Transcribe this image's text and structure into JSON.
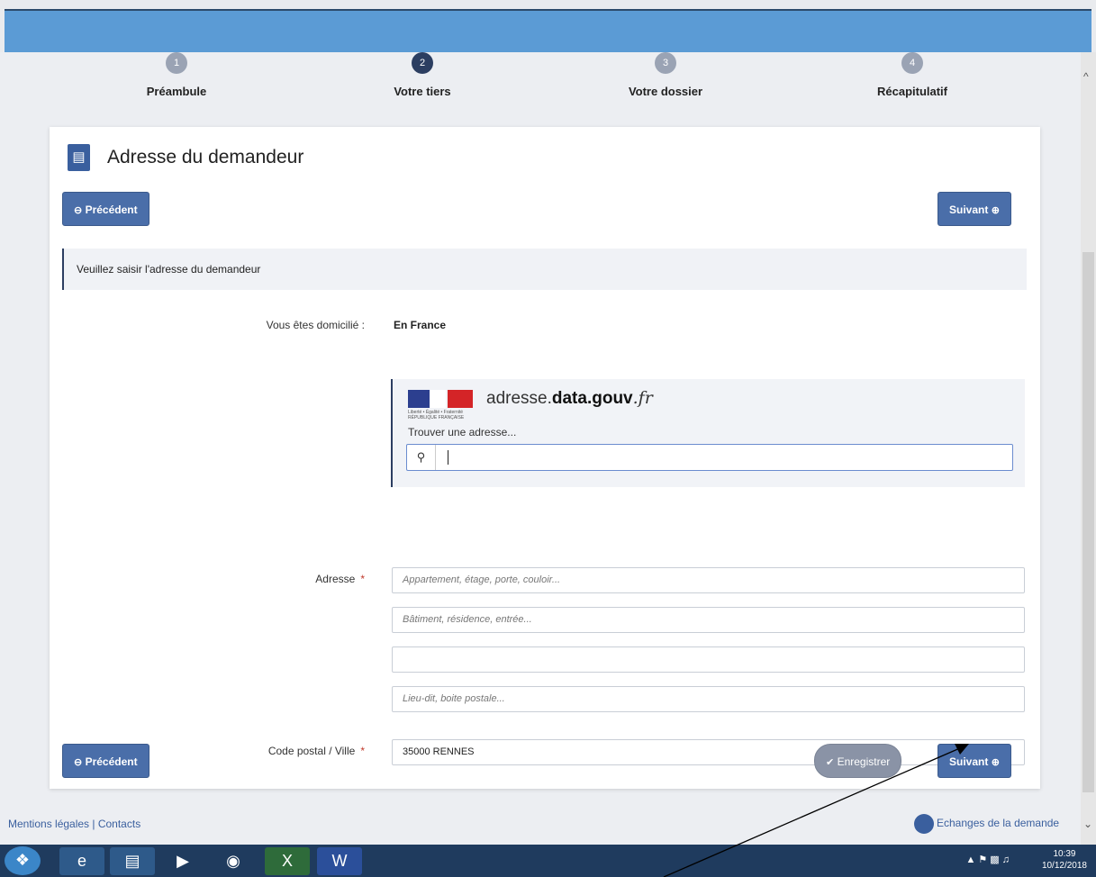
{
  "steps": [
    {
      "num": "1",
      "label": "Préambule"
    },
    {
      "num": "2",
      "label": "Votre tiers"
    },
    {
      "num": "3",
      "label": "Votre dossier"
    },
    {
      "num": "4",
      "label": "Récapitulatif"
    }
  ],
  "card": {
    "title": "Adresse du demandeur"
  },
  "nav": {
    "prev_label": "Précédent",
    "next_label": "Suivant",
    "save_label": "Enregistrer"
  },
  "info": "Veuillez saisir l'adresse du demandeur",
  "domicile": {
    "label": "Vous êtes domicilié :",
    "value": "En France"
  },
  "address_widget": {
    "logo_text_1": "adresse.",
    "logo_text_2": "data",
    "logo_text_3": ".gouv",
    "logo_text_4": ".fr",
    "logo_caption": "Liberté • Égalité • Fraternité RÉPUBLIQUE FRANÇAISE",
    "find_label": "Trouver une adresse...",
    "search_value": ""
  },
  "adresse": {
    "label": "Adresse",
    "required_mark": "*",
    "line1_placeholder": "Appartement, étage, porte, couloir...",
    "line2_placeholder": "Bâtiment, résidence, entrée...",
    "line3_value": "",
    "line4_placeholder": "Lieu-dit, boite postale..."
  },
  "ville": {
    "label": "Code postal / Ville",
    "required_mark": "*",
    "value": "35000 RENNES"
  },
  "footer": {
    "links": "Mentions légales | Contacts",
    "exchanges": "Echanges de la demande"
  },
  "taskbar": {
    "time": "10:39",
    "date": "10/12/2018"
  },
  "colors": {
    "primary": "#4a6ea9",
    "header_blue": "#5b9bd5",
    "active_step": "#2c3e61",
    "required": "#c0392b"
  }
}
